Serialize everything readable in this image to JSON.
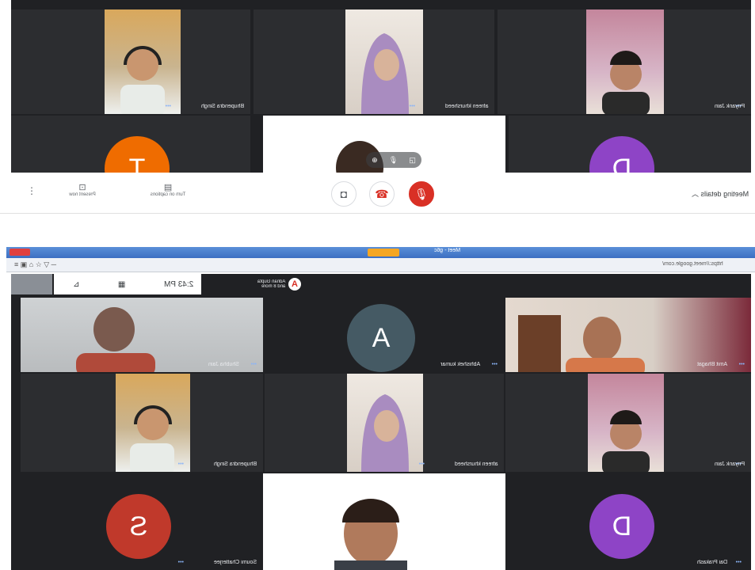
{
  "top_call": {
    "participants": [
      {
        "name": "Bhupendra Singh"
      },
      {
        "name": "afreen khursheed"
      },
      {
        "name": "Priyank Jain"
      },
      {
        "name": "T",
        "avatar_letter": "T",
        "avatar_color": "#ef6c00"
      },
      {
        "name": "",
        "avatar_letter": ""
      },
      {
        "name": "D",
        "avatar_letter": "D",
        "avatar_color": "#8e44c6"
      }
    ],
    "toolbar": {
      "present_now": "Present now",
      "captions": "Turn on captions",
      "meeting_details": "Meeting details"
    }
  },
  "bottom_call": {
    "browser_title": "Meet - g6c",
    "url": "https://meet.google.com/",
    "clock": "2:43 PM",
    "presenter": {
      "letter": "A",
      "line1": "Adnan Gupta",
      "line2": "and 8 more"
    },
    "participants": [
      {
        "name": "Shubha Jain"
      },
      {
        "name": "Abhishek kumar",
        "avatar_letter": "A",
        "avatar_color": "#455a64"
      },
      {
        "name": "Amit Bhagat"
      },
      {
        "name": "Bhupendra Singh"
      },
      {
        "name": "afreen khursheed"
      },
      {
        "name": "Priyank Jain"
      },
      {
        "name": "Soumi Chatterjee",
        "avatar_letter": "S",
        "avatar_color": "#c0392b"
      },
      {
        "name": ""
      },
      {
        "name": "Dai Prakash",
        "avatar_letter": "D",
        "avatar_color": "#8e44c6"
      }
    ]
  },
  "colors": {
    "grid_bg": "#202124",
    "tile_bg": "#2c2d30",
    "end_call_red": "#d93025"
  }
}
